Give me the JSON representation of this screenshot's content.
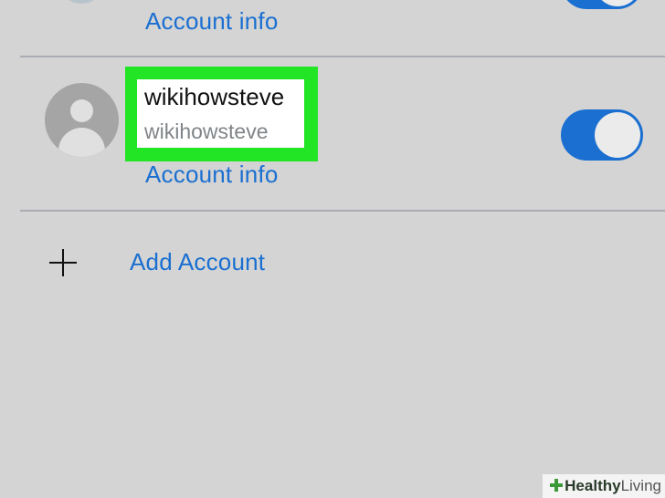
{
  "top_account": {
    "account_info_label": "Account info",
    "toggle_on": true
  },
  "account": {
    "display_name": "wikihowsteve",
    "username": "wikihowsteve",
    "account_info_label": "Account info",
    "toggle_on": true
  },
  "add_account": {
    "label": "Add Account",
    "icon": "plus-icon"
  },
  "watermark": {
    "part1": "Healthy",
    "part2": "Living"
  },
  "colors": {
    "accent": "#1a6fd1",
    "highlight": "#22e526",
    "background": "#d4d4d4"
  }
}
